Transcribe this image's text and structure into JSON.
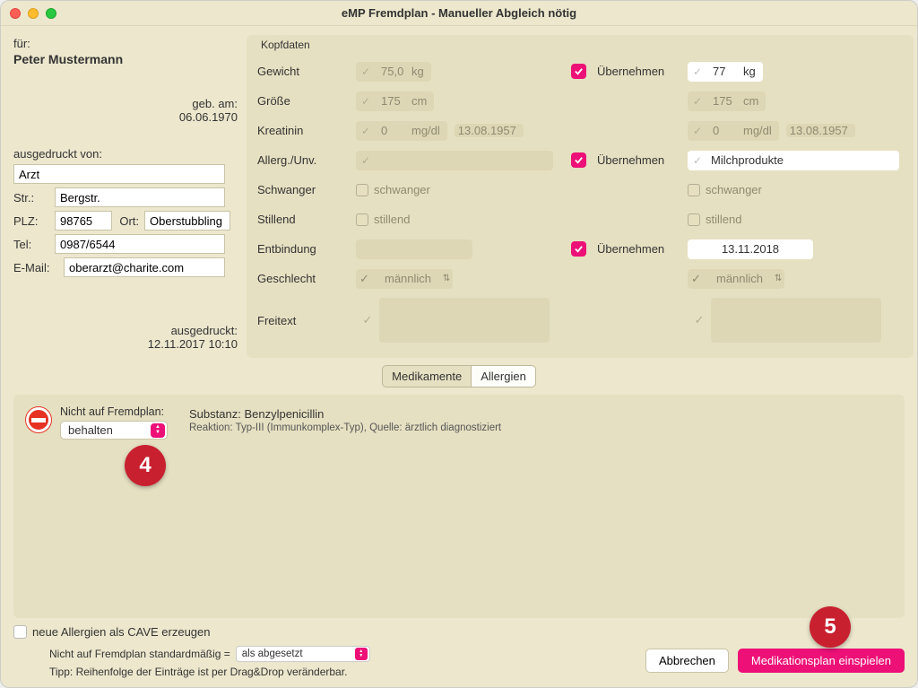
{
  "window": {
    "title": "eMP Fremdplan - Manueller Abgleich nötig"
  },
  "left": {
    "fuer_label": "für:",
    "patient_name": "Peter Mustermann",
    "geb_label": "geb. am:",
    "geb_date": "06.06.1970",
    "ausgedruckt_von_label": "ausgedruckt von:",
    "arzt_value": "Arzt",
    "str_label": "Str.:",
    "str_value": "Bergstr.",
    "plz_label": "PLZ:",
    "plz_value": "98765",
    "ort_label": "Ort:",
    "ort_value": "Oberstubbling",
    "tel_label": "Tel:",
    "tel_value": "0987/6544",
    "email_label": "E-Mail:",
    "email_value": "oberarzt@charite.com",
    "ausgedruckt_label": "ausgedruckt:",
    "ausgedruckt_ts": "12.11.2017 10:10"
  },
  "kopf": {
    "header": "Kopfdaten",
    "uebernehmen": "Übernehmen",
    "gewicht": {
      "label": "Gewicht",
      "left_val": "75,0",
      "unit": "kg",
      "right_val": "77"
    },
    "groesse": {
      "label": "Größe",
      "left_val": "175",
      "unit": "cm",
      "right_val": "175"
    },
    "kreatinin": {
      "label": "Kreatinin",
      "left_val": "0",
      "unit": "mg/dl",
      "left_date": "13.08.1957",
      "right_val": "0",
      "right_date": "13.08.1957"
    },
    "allerg": {
      "label": "Allerg./Unv.",
      "right_val": "Milchprodukte"
    },
    "schwanger": {
      "label": "Schwanger",
      "txt": "schwanger"
    },
    "stillend": {
      "label": "Stillend",
      "txt": "stillend"
    },
    "entbindung": {
      "label": "Entbindung",
      "right_date": "13.11.2018"
    },
    "geschlecht": {
      "label": "Geschlecht",
      "val": "männlich"
    },
    "freitext": {
      "label": "Freitext"
    }
  },
  "tabs": {
    "med": "Medikamente",
    "allerg": "Allergien"
  },
  "allergy": {
    "nicht_label": "Nicht auf Fremdplan:",
    "behalten": "behalten",
    "substanz_label": "Substanz:",
    "substanz_val": "Benzylpenicillin",
    "reaktion": "Reaktion: Typ-III (Immunkomplex-Typ), Quelle: ärztlich diagnostiziert",
    "callout4": "4"
  },
  "bottom": {
    "cave": "neue Allergien als CAVE erzeugen",
    "std_label": "Nicht auf Fremdplan standardmäßig =",
    "std_val": "als abgesetzt",
    "tip": "Tipp: Reihenfolge der Einträge ist per Drag&Drop veränderbar.",
    "abbrechen": "Abbrechen",
    "einspielen": "Medikationsplan einspielen",
    "callout5": "5"
  }
}
